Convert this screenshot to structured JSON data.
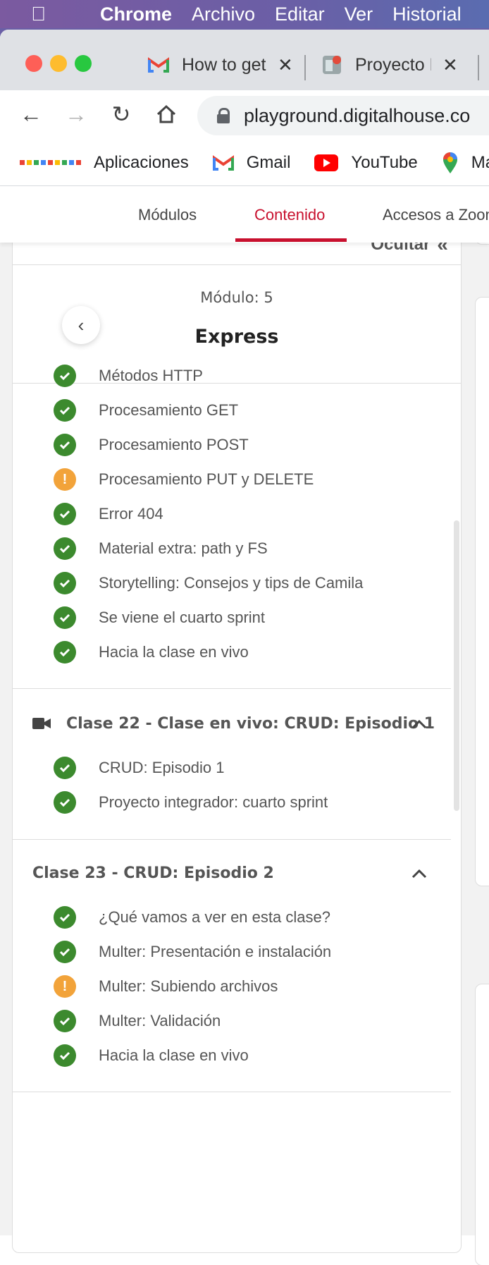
{
  "menubar": {
    "app": "Chrome",
    "items": [
      "Archivo",
      "Editar",
      "Ver",
      "Historial"
    ]
  },
  "tabs": [
    {
      "title": "How to get",
      "icon": "gmail-icon"
    },
    {
      "title": "Proyecto E",
      "icon": "project-icon"
    }
  ],
  "toolbar": {
    "url": "playground.digitalhouse.co"
  },
  "bookmarks": [
    {
      "label": "Aplicaciones",
      "icon": "apps-grid-icon"
    },
    {
      "label": "Gmail",
      "icon": "gmail-icon"
    },
    {
      "label": "YouTube",
      "icon": "youtube-icon"
    },
    {
      "label": "Maps",
      "icon": "maps-pin-icon"
    }
  ],
  "subnav": {
    "tabs": [
      "Módulos",
      "Contenido",
      "Accesos a Zoom"
    ],
    "active": "Contenido"
  },
  "sidebar": {
    "hide_label": "Ocultar",
    "module_label": "Módulo: 5",
    "module_title": "Express"
  },
  "lessons_top": [
    {
      "label": "Métodos HTTP",
      "status": "done"
    },
    {
      "label": "Procesamiento GET",
      "status": "done"
    },
    {
      "label": "Procesamiento POST",
      "status": "done"
    },
    {
      "label": "Procesamiento PUT y DELETE",
      "status": "pending"
    },
    {
      "label": "Error 404",
      "status": "done"
    },
    {
      "label": "Material extra: path y FS",
      "status": "done"
    },
    {
      "label": "Storytelling: Consejos y tips de Camila",
      "status": "done"
    },
    {
      "label": "Se viene el cuarto sprint",
      "status": "done"
    },
    {
      "label": "Hacia la clase en vivo",
      "status": "done"
    }
  ],
  "class22": {
    "title": "Clase 22 - Clase en vivo: CRUD: Episodio 1",
    "items": [
      {
        "label": "CRUD: Episodio 1",
        "status": "done"
      },
      {
        "label": "Proyecto integrador: cuarto sprint",
        "status": "done"
      }
    ]
  },
  "class23": {
    "title": "Clase 23 - CRUD: Episodio 2",
    "items": [
      {
        "label": "¿Qué vamos a ver en esta clase?",
        "status": "done"
      },
      {
        "label": "Multer: Presentación e instalación",
        "status": "done"
      },
      {
        "label": "Multer: Subiendo archivos",
        "status": "pending"
      },
      {
        "label": "Multer: Validación",
        "status": "done"
      },
      {
        "label": "Hacia la clase en vivo",
        "status": "done"
      }
    ]
  },
  "colors": {
    "done": "#3c8a2e",
    "pending": "#f2a33a",
    "accent": "#c8102e"
  }
}
